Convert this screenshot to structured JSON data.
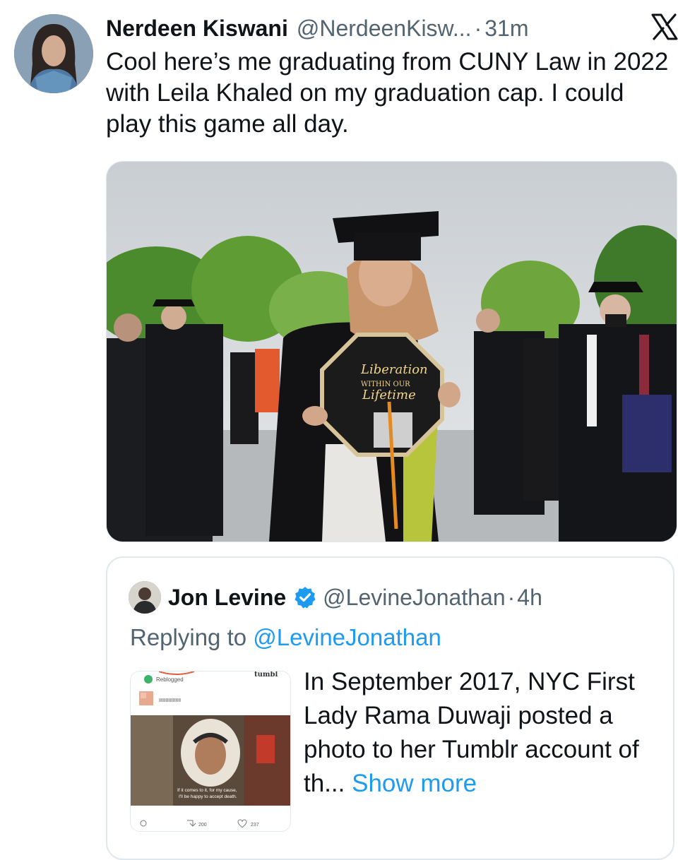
{
  "tweet": {
    "author_name": "Nerdeen Kiswani",
    "handle": "@NerdeenKisw...",
    "separator": "·",
    "time": "31m",
    "text": "Cool here’s me graduating from CUNY Law in 2022 with Leila Khaled on my graduation cap. I could play this game all day.",
    "media": {
      "cap_text_line1": "Liberation",
      "cap_text_line2": "WITHIN OUR",
      "cap_text_line3": "Lifetime"
    }
  },
  "quoted_tweet": {
    "author_name": "Jon Levine",
    "verified": true,
    "handle": "@LevineJonathan",
    "separator": "·",
    "time": "4h",
    "replying_prefix": "Replying to",
    "replying_to": "@LevineJonathan",
    "text": "In September 2017, NYC First Lady Rama Duwaji posted a photo to her Tumblr account of th...",
    "show_more": "Show more",
    "thumbnail": {
      "reblogged_label": "Reblogged",
      "site_label": "tumbl",
      "blurred_user": "IIIIIIIIIIIIIIII",
      "subtitle_line1": "If it comes to it, for my cause,",
      "subtitle_line2": "I'll be happy to accept death.",
      "reblogs": "200",
      "likes": "237"
    }
  },
  "colors": {
    "link_blue": "#1d9bf0",
    "secondary_text": "#536471",
    "primary_text": "#0f1419",
    "border": "#e1e8ed"
  },
  "icons": [
    "x-logo-icon",
    "verified-badge-icon",
    "reply-icon",
    "retweet-icon",
    "heart-icon"
  ]
}
